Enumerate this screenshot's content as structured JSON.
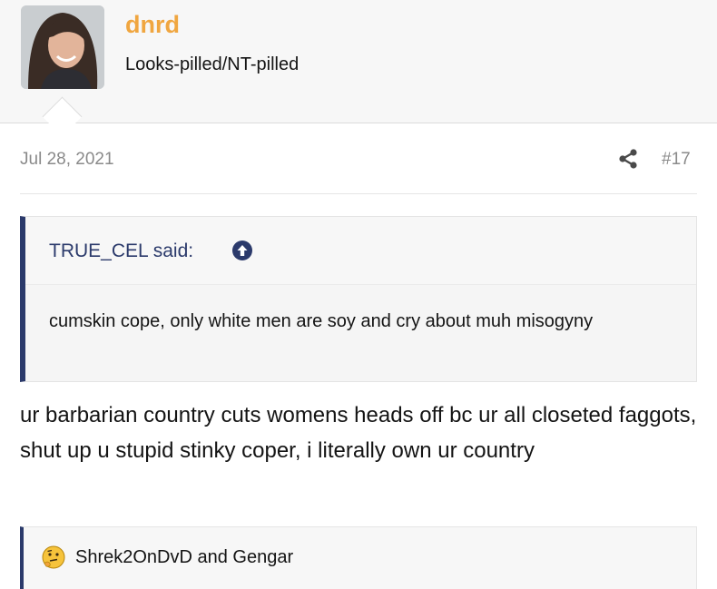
{
  "user": {
    "name": "dnrd",
    "title": "Looks-pilled/NT-pilled",
    "name_color": "#f0a640"
  },
  "post": {
    "date": "Jul 28, 2021",
    "number": "#17",
    "share_icon": "share-icon",
    "body": "ur barbarian country cuts womens heads off bc ur all closeted faggots, shut up u stupid stinky coper, i literally own ur country"
  },
  "quote": {
    "author": "TRUE_CEL said:",
    "icon": "arrow-up-circle-icon",
    "text": "cumskin cope, only white men are soy and cry about muh misogyny",
    "accent_color": "#2b3a6b"
  },
  "reactions": {
    "icon": "thinking-face-icon",
    "users": "Shrek2OnDvD and Gengar"
  }
}
